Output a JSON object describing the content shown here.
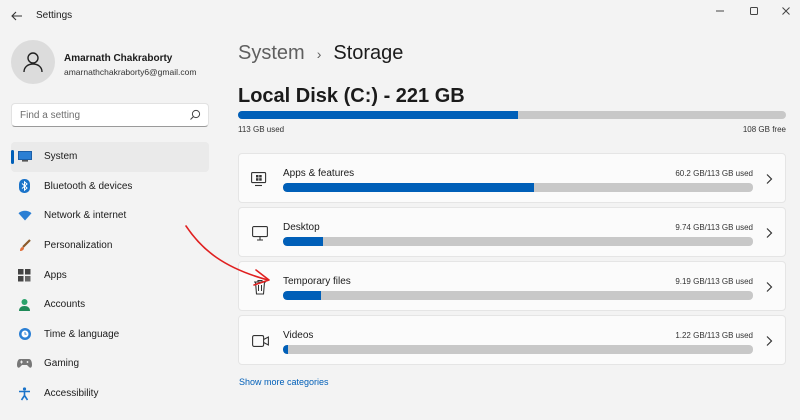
{
  "window": {
    "title": "Settings"
  },
  "user": {
    "name": "Amarnath Chakraborty",
    "email": "amarnathchakraborty6@gmail.com"
  },
  "search": {
    "placeholder": "Find a setting"
  },
  "sidebar": {
    "items": [
      {
        "label": "System",
        "icon": "monitor-icon",
        "selected": true
      },
      {
        "label": "Bluetooth & devices",
        "icon": "bluetooth-icon"
      },
      {
        "label": "Network & internet",
        "icon": "wifi-icon"
      },
      {
        "label": "Personalization",
        "icon": "brush-icon"
      },
      {
        "label": "Apps",
        "icon": "apps-icon"
      },
      {
        "label": "Accounts",
        "icon": "person-icon"
      },
      {
        "label": "Time & language",
        "icon": "globe-clock-icon"
      },
      {
        "label": "Gaming",
        "icon": "gamepad-icon"
      },
      {
        "label": "Accessibility",
        "icon": "accessibility-icon"
      }
    ]
  },
  "breadcrumb": {
    "parent": "System",
    "separator": "›",
    "current": "Storage"
  },
  "disk": {
    "title": "Local Disk (C:) - 221 GB",
    "used_label": "113 GB used",
    "free_label": "108 GB free",
    "used_fraction": 0.511
  },
  "categories": [
    {
      "name": "Apps & features",
      "usage": "60.2 GB/113 GB used",
      "fraction": 0.533,
      "icon": "apps-features-icon"
    },
    {
      "name": "Desktop",
      "usage": "9.74 GB/113 GB used",
      "fraction": 0.086,
      "icon": "desktop-icon"
    },
    {
      "name": "Temporary files",
      "usage": "9.19 GB/113 GB used",
      "fraction": 0.081,
      "icon": "trash-icon"
    },
    {
      "name": "Videos",
      "usage": "1.22 GB/113 GB used",
      "fraction": 0.011,
      "icon": "video-icon"
    }
  ],
  "show_more": "Show more categories",
  "colors": {
    "accent": "#005fb8",
    "bar_track": "#c8c8c8",
    "annotation": "#e02020"
  }
}
